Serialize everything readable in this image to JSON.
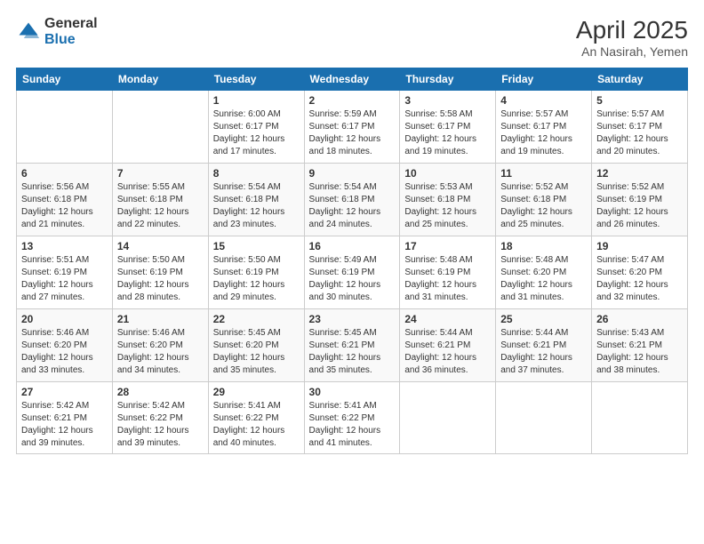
{
  "header": {
    "logo_general": "General",
    "logo_blue": "Blue",
    "title": "April 2025",
    "location": "An Nasirah, Yemen"
  },
  "days_of_week": [
    "Sunday",
    "Monday",
    "Tuesday",
    "Wednesday",
    "Thursday",
    "Friday",
    "Saturday"
  ],
  "weeks": [
    [
      {
        "day": "",
        "info": ""
      },
      {
        "day": "",
        "info": ""
      },
      {
        "day": "1",
        "info": "Sunrise: 6:00 AM\nSunset: 6:17 PM\nDaylight: 12 hours and 17 minutes."
      },
      {
        "day": "2",
        "info": "Sunrise: 5:59 AM\nSunset: 6:17 PM\nDaylight: 12 hours and 18 minutes."
      },
      {
        "day": "3",
        "info": "Sunrise: 5:58 AM\nSunset: 6:17 PM\nDaylight: 12 hours and 19 minutes."
      },
      {
        "day": "4",
        "info": "Sunrise: 5:57 AM\nSunset: 6:17 PM\nDaylight: 12 hours and 19 minutes."
      },
      {
        "day": "5",
        "info": "Sunrise: 5:57 AM\nSunset: 6:17 PM\nDaylight: 12 hours and 20 minutes."
      }
    ],
    [
      {
        "day": "6",
        "info": "Sunrise: 5:56 AM\nSunset: 6:18 PM\nDaylight: 12 hours and 21 minutes."
      },
      {
        "day": "7",
        "info": "Sunrise: 5:55 AM\nSunset: 6:18 PM\nDaylight: 12 hours and 22 minutes."
      },
      {
        "day": "8",
        "info": "Sunrise: 5:54 AM\nSunset: 6:18 PM\nDaylight: 12 hours and 23 minutes."
      },
      {
        "day": "9",
        "info": "Sunrise: 5:54 AM\nSunset: 6:18 PM\nDaylight: 12 hours and 24 minutes."
      },
      {
        "day": "10",
        "info": "Sunrise: 5:53 AM\nSunset: 6:18 PM\nDaylight: 12 hours and 25 minutes."
      },
      {
        "day": "11",
        "info": "Sunrise: 5:52 AM\nSunset: 6:18 PM\nDaylight: 12 hours and 25 minutes."
      },
      {
        "day": "12",
        "info": "Sunrise: 5:52 AM\nSunset: 6:19 PM\nDaylight: 12 hours and 26 minutes."
      }
    ],
    [
      {
        "day": "13",
        "info": "Sunrise: 5:51 AM\nSunset: 6:19 PM\nDaylight: 12 hours and 27 minutes."
      },
      {
        "day": "14",
        "info": "Sunrise: 5:50 AM\nSunset: 6:19 PM\nDaylight: 12 hours and 28 minutes."
      },
      {
        "day": "15",
        "info": "Sunrise: 5:50 AM\nSunset: 6:19 PM\nDaylight: 12 hours and 29 minutes."
      },
      {
        "day": "16",
        "info": "Sunrise: 5:49 AM\nSunset: 6:19 PM\nDaylight: 12 hours and 30 minutes."
      },
      {
        "day": "17",
        "info": "Sunrise: 5:48 AM\nSunset: 6:19 PM\nDaylight: 12 hours and 31 minutes."
      },
      {
        "day": "18",
        "info": "Sunrise: 5:48 AM\nSunset: 6:20 PM\nDaylight: 12 hours and 31 minutes."
      },
      {
        "day": "19",
        "info": "Sunrise: 5:47 AM\nSunset: 6:20 PM\nDaylight: 12 hours and 32 minutes."
      }
    ],
    [
      {
        "day": "20",
        "info": "Sunrise: 5:46 AM\nSunset: 6:20 PM\nDaylight: 12 hours and 33 minutes."
      },
      {
        "day": "21",
        "info": "Sunrise: 5:46 AM\nSunset: 6:20 PM\nDaylight: 12 hours and 34 minutes."
      },
      {
        "day": "22",
        "info": "Sunrise: 5:45 AM\nSunset: 6:20 PM\nDaylight: 12 hours and 35 minutes."
      },
      {
        "day": "23",
        "info": "Sunrise: 5:45 AM\nSunset: 6:21 PM\nDaylight: 12 hours and 35 minutes."
      },
      {
        "day": "24",
        "info": "Sunrise: 5:44 AM\nSunset: 6:21 PM\nDaylight: 12 hours and 36 minutes."
      },
      {
        "day": "25",
        "info": "Sunrise: 5:44 AM\nSunset: 6:21 PM\nDaylight: 12 hours and 37 minutes."
      },
      {
        "day": "26",
        "info": "Sunrise: 5:43 AM\nSunset: 6:21 PM\nDaylight: 12 hours and 38 minutes."
      }
    ],
    [
      {
        "day": "27",
        "info": "Sunrise: 5:42 AM\nSunset: 6:21 PM\nDaylight: 12 hours and 39 minutes."
      },
      {
        "day": "28",
        "info": "Sunrise: 5:42 AM\nSunset: 6:22 PM\nDaylight: 12 hours and 39 minutes."
      },
      {
        "day": "29",
        "info": "Sunrise: 5:41 AM\nSunset: 6:22 PM\nDaylight: 12 hours and 40 minutes."
      },
      {
        "day": "30",
        "info": "Sunrise: 5:41 AM\nSunset: 6:22 PM\nDaylight: 12 hours and 41 minutes."
      },
      {
        "day": "",
        "info": ""
      },
      {
        "day": "",
        "info": ""
      },
      {
        "day": "",
        "info": ""
      }
    ]
  ]
}
